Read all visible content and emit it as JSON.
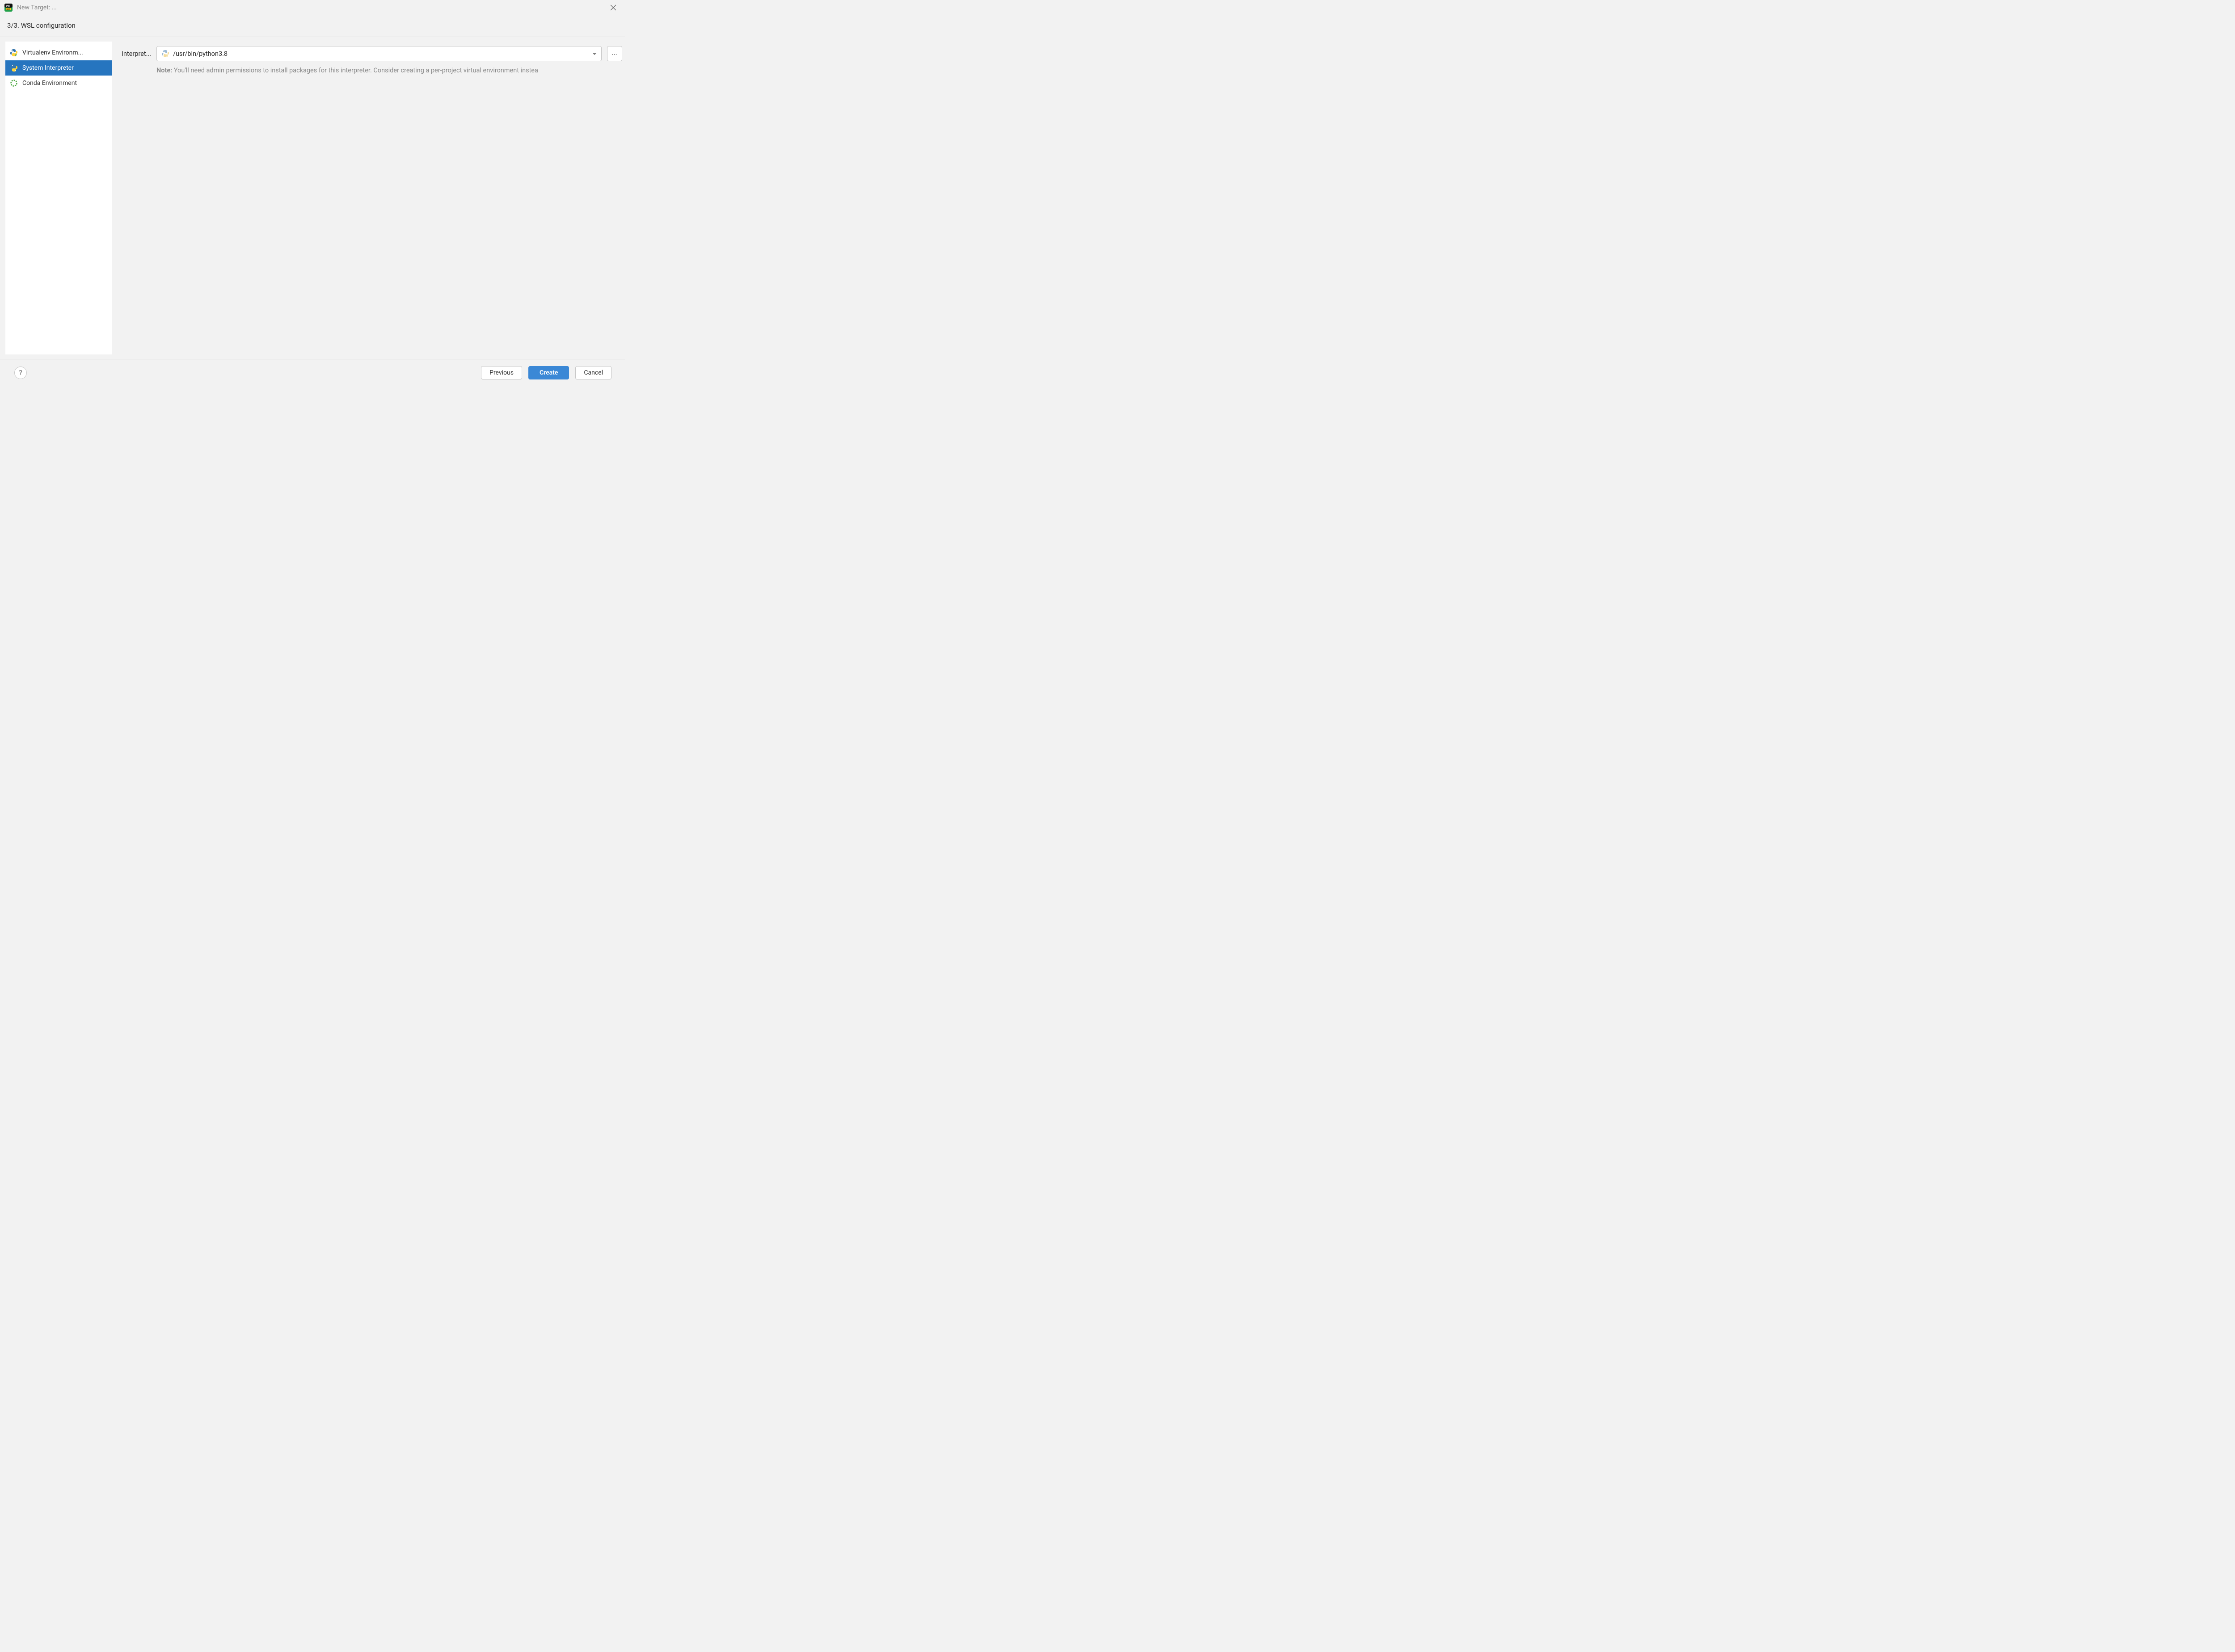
{
  "titlebar": {
    "title": "New Target: ..."
  },
  "step": {
    "label": "3/3. WSL configuration"
  },
  "sidebar": {
    "items": [
      {
        "label": "Virtualenv Environm..."
      },
      {
        "label": "System Interpreter"
      },
      {
        "label": "Conda Environment"
      }
    ],
    "selected_index": 1
  },
  "form": {
    "interpreter_label": "Interpret...",
    "interpreter_value": "/usr/bin/python3.8",
    "browse_label": "...",
    "note_label": "Note:",
    "note_text": " You'll need admin permissions to install packages for this interpreter. Consider creating a per-project virtual environment instea"
  },
  "footer": {
    "help_label": "?",
    "previous_label": "Previous",
    "create_label": "Create",
    "cancel_label": "Cancel"
  }
}
